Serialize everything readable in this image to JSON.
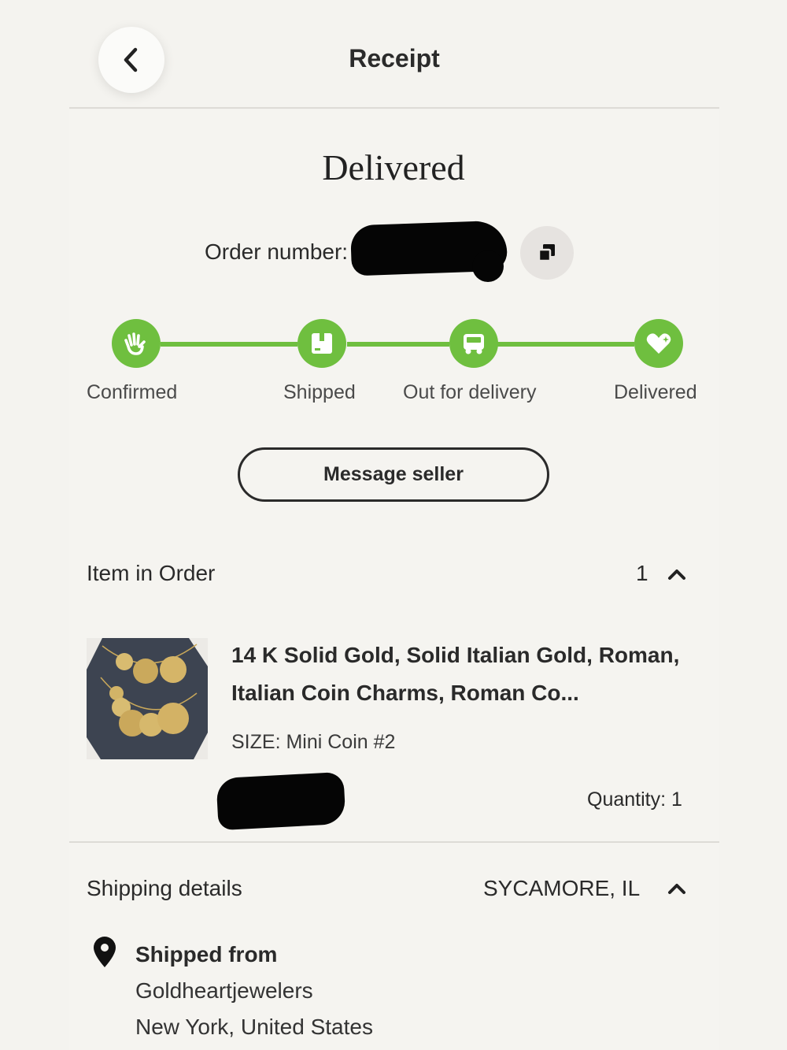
{
  "header": {
    "title": "Receipt"
  },
  "status": {
    "title": "Delivered"
  },
  "order": {
    "label": "Order number:"
  },
  "tracker": {
    "accent": "#6fbf3f",
    "steps": [
      {
        "label": "Confirmed",
        "icon": "hand-icon"
      },
      {
        "label": "Shipped",
        "icon": "box-icon"
      },
      {
        "label": "Out for delivery",
        "icon": "truck-icon"
      },
      {
        "label": "Delivered",
        "icon": "heart-icon"
      }
    ]
  },
  "actions": {
    "message_seller": "Message seller"
  },
  "items_section": {
    "title": "Item in Order",
    "count": "1",
    "item": {
      "title": "14 K Solid Gold, Solid Italian Gold, Roman, Italian Coin Charms, Roman Co...",
      "size": "SIZE: Mini Coin #2",
      "quantity": "Quantity: 1"
    }
  },
  "shipping_section": {
    "title": "Shipping details",
    "location": "SYCAMORE, IL",
    "shipped_from_label": "Shipped from",
    "seller": "Goldheartjewelers",
    "origin": "New York, United States"
  }
}
